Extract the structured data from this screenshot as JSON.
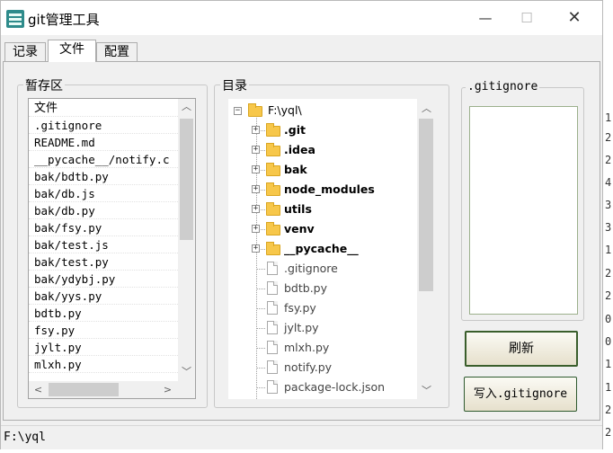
{
  "window": {
    "title": "git管理工具",
    "minimize": "—",
    "maximize": "☐",
    "close": "✕"
  },
  "tabs": [
    {
      "label": "记录",
      "active": false
    },
    {
      "label": "文件",
      "active": true
    },
    {
      "label": "配置",
      "active": false
    }
  ],
  "staging": {
    "group_label": "暂存区",
    "items": [
      "文件",
      ".gitignore",
      "README.md",
      "__pycache__/notify.c",
      "bak/bdtb.py",
      "bak/db.js",
      "bak/db.py",
      "bak/fsy.py",
      "bak/test.js",
      "bak/test.py",
      "bak/ydybj.py",
      "bak/yys.py",
      "bdtb.py",
      "fsy.py",
      "jylt.py",
      "mlxh.py"
    ]
  },
  "directory": {
    "group_label": "目录",
    "root": "F:\\yql\\",
    "folders": [
      ".git",
      ".idea",
      "bak",
      "node_modules",
      "utils",
      "venv",
      "__pycache__"
    ],
    "files": [
      ".gitignore",
      "bdtb.py",
      "fsy.py",
      "jylt.py",
      "mlxh.py",
      "notify.py",
      "package-lock.json"
    ]
  },
  "gitignore": {
    "group_label": ".gitignore",
    "content": ""
  },
  "buttons": {
    "refresh": "刷新",
    "write": "写入.gitignore"
  },
  "status": {
    "path": "F:\\yql"
  },
  "background_digits": [
    "1",
    "2",
    "2",
    "4",
    "3",
    "3",
    "1",
    "2",
    "2",
    "0",
    "0",
    "1",
    "1",
    "2",
    "2"
  ],
  "colors": {
    "folder": "#f7c74a",
    "button_border": "#2f5a2f",
    "textarea_border": "#9cb08c"
  }
}
